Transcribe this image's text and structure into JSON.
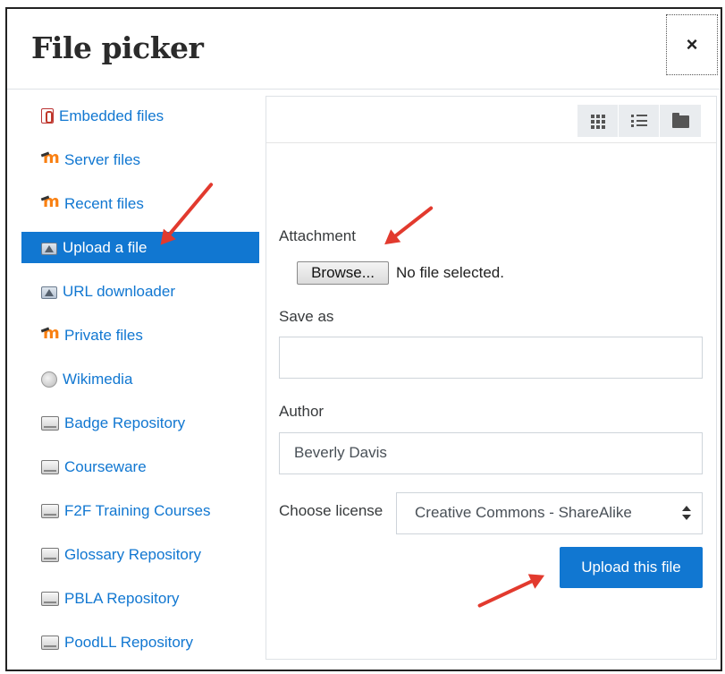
{
  "dialog": {
    "title": "File picker",
    "close_glyph": "×"
  },
  "sidebar": {
    "items": [
      {
        "label": "Embedded files",
        "icon": "paperclip-icon"
      },
      {
        "label": "Server files",
        "icon": "moodle-icon"
      },
      {
        "label": "Recent files",
        "icon": "moodle-icon"
      },
      {
        "label": "Upload a file",
        "icon": "upload-icon",
        "active": true
      },
      {
        "label": "URL downloader",
        "icon": "upload-icon"
      },
      {
        "label": "Private files",
        "icon": "moodle-icon"
      },
      {
        "label": "Wikimedia",
        "icon": "globe-icon"
      },
      {
        "label": "Badge Repository",
        "icon": "repository-icon"
      },
      {
        "label": "Courseware",
        "icon": "repository-icon"
      },
      {
        "label": "F2F Training Courses",
        "icon": "repository-icon"
      },
      {
        "label": "Glossary Repository",
        "icon": "repository-icon"
      },
      {
        "label": "PBLA Repository",
        "icon": "repository-icon"
      },
      {
        "label": "PoodLL Repository",
        "icon": "repository-icon"
      }
    ]
  },
  "toolbar": {
    "views": [
      "grid-view-icon",
      "list-view-icon",
      "folder-view-icon"
    ]
  },
  "form": {
    "attachment_label": "Attachment",
    "browse_label": "Browse...",
    "file_status": "No file selected.",
    "save_as_label": "Save as",
    "save_as_value": "",
    "author_label": "Author",
    "author_value": "Beverly Davis",
    "license_label": "Choose license",
    "license_value": "Creative Commons - ShareAlike",
    "upload_label": "Upload this file"
  },
  "colors": {
    "accent": "#1177d1",
    "annotation_arrow": "#e23a2e"
  }
}
